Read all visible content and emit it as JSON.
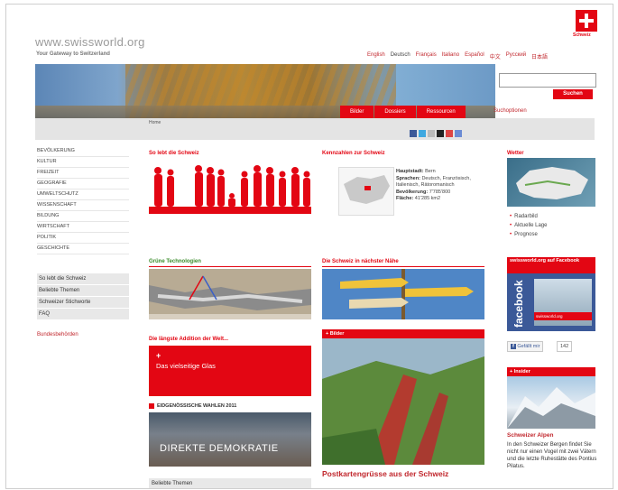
{
  "header": {
    "site_url": "www.swissworld.org",
    "tagline": "Your Gateway to Switzerland",
    "flag_caption": "Schweiz",
    "languages": [
      "English",
      "Deutsch",
      "Français",
      "Italiano",
      "Español",
      "中文",
      "Русский",
      "日本語"
    ],
    "active_language": "Deutsch",
    "search_button": "Suchen",
    "search_value": "",
    "subnav": [
      "Bilder",
      "Dossiers",
      "Ressourcen"
    ],
    "search_options": "Suchoptionen",
    "breadcrumb": "Home"
  },
  "left_nav": {
    "items": [
      "BEVÖLKERUNG",
      "KULTUR",
      "FREIZEIT",
      "GEOGRAFIE",
      "UMWELTSCHUTZ",
      "WISSENSCHAFT",
      "BILDUNG",
      "WIRTSCHAFT",
      "POLITIK",
      "GESCHICHTE"
    ],
    "secondary": [
      "So lebt die Schweiz",
      "Beliebte Themen",
      "Schweizer Stichworte",
      "FAQ"
    ],
    "authorities_link": "Bundesbehörden"
  },
  "main": {
    "col1": {
      "title1": "So lebt die Schweiz",
      "title2": "Grüne Technologien",
      "title3": "Die längste Addition der Welt...",
      "glass_label": "Das vielseitige Glas",
      "elections_title": "EIDGENÖSSISCHE WAHLEN 2011",
      "elections_banner": "DIREKTE DEMOKRATIE",
      "popular_topics": "Beliebte Themen"
    },
    "col2": {
      "title1": "Kennzahlen zur Schweiz",
      "facts": [
        {
          "label": "Hauptstadt:",
          "value": "Bern"
        },
        {
          "label": "Sprachen:",
          "value": "Deutsch, Französisch, Italienisch, Rätoromanisch"
        },
        {
          "label": "Bevölkerung:",
          "value": "7'785'800"
        },
        {
          "label": "Fläche:",
          "value": "41'285 km2"
        }
      ],
      "title2": "Die Schweiz in nächster Nähe",
      "bilder_header": "Bilder",
      "postcard_title": "Postkartengrüsse aus der Schweiz"
    },
    "col3": {
      "weather_title": "Wetter",
      "weather_links": [
        "Radarbild",
        "Aktuelle Lage",
        "Prognose"
      ],
      "facebook_header": "swissworld.org auf Facebook",
      "facebook_caption": "swissworld.org",
      "facebook_word": "facebook",
      "like_label": "Gefällt mir",
      "like_count": "142",
      "insider_header": "Insider",
      "insider_title": "Schweizer Alpen",
      "insider_text": "In den Schweizer Bergen findet Sie nicht nur einen Vogel mit zwei Vätern und die letzte Ruhestätte des Pontius Pilatus."
    }
  },
  "colors": {
    "accent": "#e30613",
    "nav_grey": "#e4e4e4",
    "green_title": "#3a8c2a",
    "facebook_blue": "#3b5998"
  }
}
